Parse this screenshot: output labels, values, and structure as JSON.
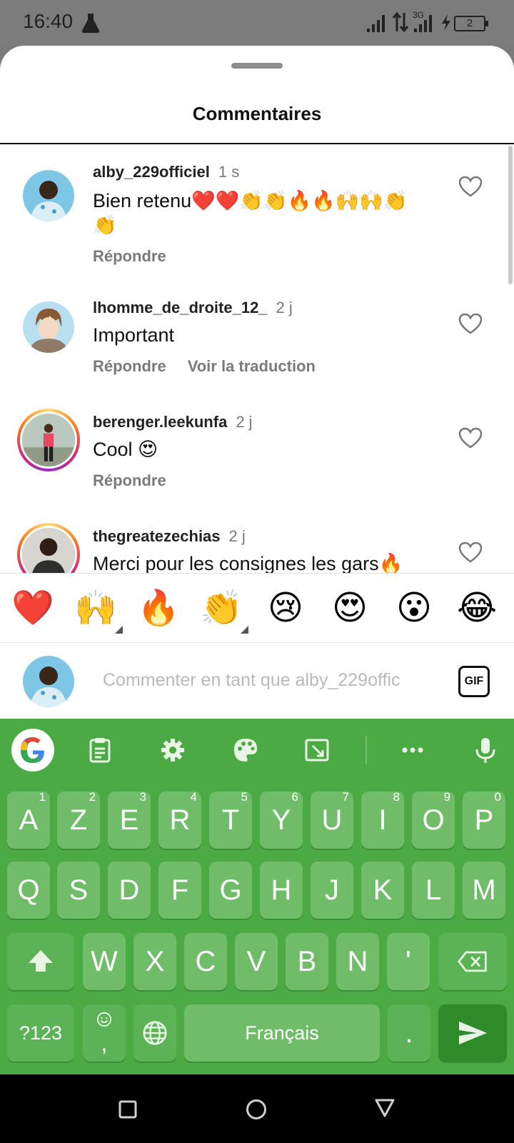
{
  "status_bar": {
    "time": "16:40",
    "network": "3G",
    "battery": "2"
  },
  "sheet": {
    "title": "Commentaires"
  },
  "comments": [
    {
      "username": "alby_229officiel",
      "age": "1 s",
      "text": "Bien retenu❤️❤️👏👏🔥🔥🙌🙌👏👏",
      "actions": [
        "Répondre"
      ]
    },
    {
      "username": "lhomme_de_droite_12_",
      "age": "2 j",
      "text": "Important",
      "actions": [
        "Répondre",
        "Voir la traduction"
      ]
    },
    {
      "username": "berenger.leekunfa",
      "age": "2 j",
      "text": "Cool 😍",
      "actions": [
        "Répondre"
      ]
    },
    {
      "username": "thegreatezechias",
      "age": "2 j",
      "text": "Merci pour les consignes les gars🔥",
      "actions": []
    }
  ],
  "reactions": [
    "❤️",
    "🙌",
    "🔥",
    "👏",
    "😢",
    "😍",
    "😮",
    "😂"
  ],
  "comment_input": {
    "placeholder": "Commenter en tant que alby_229offic",
    "gif_label": "GIF"
  },
  "keyboard": {
    "row1": [
      {
        "label": "A",
        "num": "1"
      },
      {
        "label": "Z",
        "num": "2"
      },
      {
        "label": "E",
        "num": "3"
      },
      {
        "label": "R",
        "num": "4"
      },
      {
        "label": "T",
        "num": "5"
      },
      {
        "label": "Y",
        "num": "6"
      },
      {
        "label": "U",
        "num": "7"
      },
      {
        "label": "I",
        "num": "8"
      },
      {
        "label": "O",
        "num": "9"
      },
      {
        "label": "P",
        "num": "0"
      }
    ],
    "row2": [
      "Q",
      "S",
      "D",
      "F",
      "G",
      "H",
      "J",
      "K",
      "L",
      "M"
    ],
    "row3": [
      "W",
      "X",
      "C",
      "V",
      "B",
      "N",
      "'"
    ],
    "symbols_label": "?123",
    "comma_label": ",",
    "space_label": "Français",
    "period_label": "."
  },
  "colors": {
    "keyboard_bg": "#4caa45",
    "key_bg": "#6fbd68",
    "enter_key_bg": "#2f8a2a"
  }
}
